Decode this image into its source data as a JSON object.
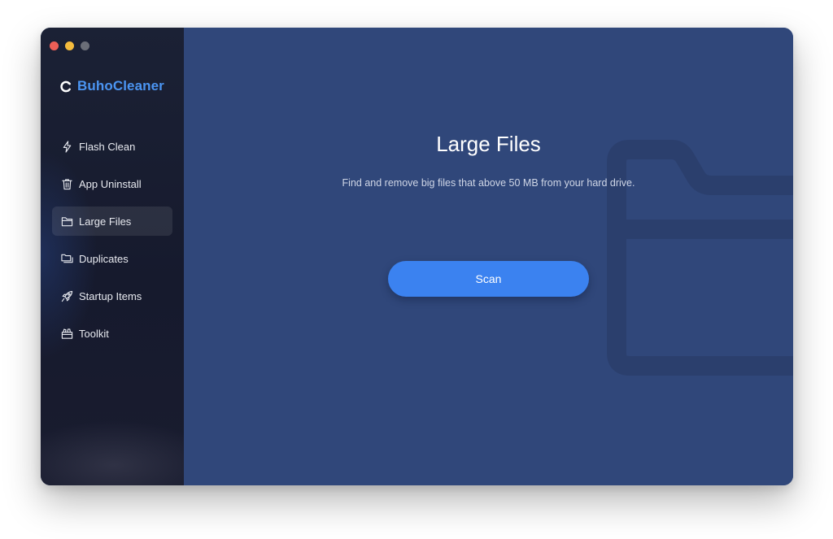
{
  "window": {
    "traffic_lights": {
      "close_color": "#ed5f57",
      "minimize_color": "#f4bb3d",
      "zoom_color": "#6b6e78"
    }
  },
  "sidebar": {
    "brand": {
      "name": "BuhoCleaner",
      "logo_icon": "buho-logo-icon",
      "color": "#4b95f2"
    },
    "items": [
      {
        "label": "Flash Clean",
        "icon": "lightning-icon",
        "active": false
      },
      {
        "label": "App Uninstall",
        "icon": "trash-icon",
        "active": false
      },
      {
        "label": "Large Files",
        "icon": "folder-icon",
        "active": true
      },
      {
        "label": "Duplicates",
        "icon": "duplicate-folders-icon",
        "active": false
      },
      {
        "label": "Startup Items",
        "icon": "rocket-icon",
        "active": false
      },
      {
        "label": "Toolkit",
        "icon": "toolkit-icon",
        "active": false
      }
    ]
  },
  "main": {
    "title": "Large Files",
    "subtitle": "Find and remove big files that above 50 MB from your hard drive.",
    "scan_label": "Scan",
    "background_icon": "large-folder-icon",
    "accent_color": "#3b82f0",
    "background_color": "#30477a"
  }
}
